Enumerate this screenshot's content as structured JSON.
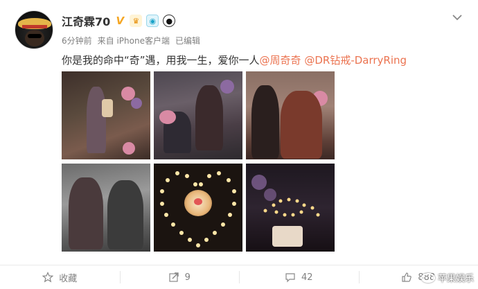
{
  "post": {
    "username": "江奇霖70",
    "vip": "V",
    "badges": [
      "crown-icon",
      "camera-icon",
      "panda-icon"
    ],
    "time": "6分钟前",
    "source": "来自 iPhone客户端",
    "edited": "已编辑",
    "text_prefix": "你是我的命中“奇”遇，用我一生，爱你一人",
    "mention_1": "@周奇奇",
    "mention_2": "@DR钻戒-DarryRing"
  },
  "photos": [
    {
      "name": "photo-1"
    },
    {
      "name": "photo-2"
    },
    {
      "name": "photo-3"
    },
    {
      "name": "photo-4"
    },
    {
      "name": "photo-5"
    },
    {
      "name": "photo-6"
    }
  ],
  "actions": {
    "favorite_label": "收藏",
    "repost_count": "9",
    "comment_count": "42",
    "like_count": "888"
  },
  "watermark": "苹果娱乐",
  "colors": {
    "link": "#eb7350",
    "vip": "#f5a623",
    "meta": "#808080"
  }
}
